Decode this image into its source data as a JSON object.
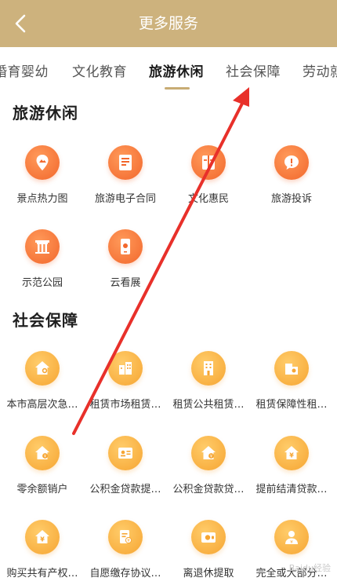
{
  "header": {
    "title": "更多服务",
    "back_icon": "chevron-left-icon"
  },
  "tabs": [
    {
      "label": "婚育婴幼"
    },
    {
      "label": "文化教育"
    },
    {
      "label": "旅游休闲",
      "active": true
    },
    {
      "label": "社会保障"
    },
    {
      "label": "劳动就业"
    }
  ],
  "sections": [
    {
      "title": "旅游休闲",
      "items": [
        {
          "label": "景点热力图",
          "icon": "map-pin-icon",
          "color": "orange"
        },
        {
          "label": "旅游电子合同",
          "icon": "contract-document-icon",
          "color": "orange"
        },
        {
          "label": "文化惠民",
          "icon": "book-icon",
          "color": "orange"
        },
        {
          "label": "旅游投诉",
          "icon": "complaint-bubble-icon",
          "color": "orange"
        },
        {
          "label": "示范公园",
          "icon": "park-gate-icon",
          "color": "orange"
        },
        {
          "label": "云看展",
          "icon": "phone-exhibition-icon",
          "color": "orange"
        }
      ]
    },
    {
      "title": "社会保障",
      "items": [
        {
          "label": "本市高层次急…",
          "icon": "house-badge-icon",
          "color": "yellow"
        },
        {
          "label": "租赁市场租赁…",
          "icon": "buildings-icon",
          "color": "yellow"
        },
        {
          "label": "租赁公共租赁…",
          "icon": "apartment-icon",
          "color": "yellow"
        },
        {
          "label": "租赁保障性租…",
          "icon": "house-key-icon",
          "color": "yellow"
        },
        {
          "label": "零余额销户",
          "icon": "house-coin-icon",
          "color": "yellow"
        },
        {
          "label": "公积金贷款提…",
          "icon": "id-card-icon",
          "color": "yellow"
        },
        {
          "label": "公积金贷款贷…",
          "icon": "house-coin-icon",
          "color": "yellow"
        },
        {
          "label": "提前结清贷款…",
          "icon": "house-yen-icon",
          "color": "yellow"
        },
        {
          "label": "购买共有产权…",
          "icon": "house-yen-icon",
          "color": "yellow"
        },
        {
          "label": "自愿缴存协议…",
          "icon": "document-yen-icon",
          "color": "yellow"
        },
        {
          "label": "离退休提取",
          "icon": "wallet-yen-icon",
          "color": "yellow"
        },
        {
          "label": "完全或大部分…",
          "icon": "person-yen-icon",
          "color": "yellow"
        }
      ]
    }
  ],
  "watermark": "Baidu经验",
  "colors": {
    "header": "#cdb27d",
    "accent": "#c8ac74",
    "orange": "#f2672c",
    "yellow": "#f6a532",
    "arrow": "#e8302a"
  }
}
